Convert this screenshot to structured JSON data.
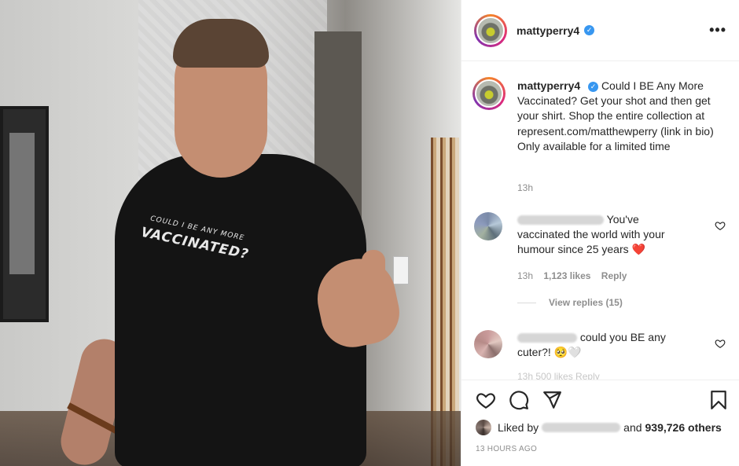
{
  "post": {
    "username": "mattyperry4",
    "verified_badge": "✓",
    "more_icon": "•••"
  },
  "photo": {
    "shirt_line1": "COULD I BE ANY MORE",
    "shirt_line2": "VACCINATED?"
  },
  "caption": {
    "username": "mattyperry4",
    "text": "Could I BE Any More Vaccinated? Get your shot and then get your shirt. Shop the entire collection at represent.com/matthewperry (link in bio) Only available for a limited time",
    "time": "13h"
  },
  "comments": [
    {
      "text": "You've vaccinated the world with your humour since 25 years",
      "emoji": "❤️",
      "time": "13h",
      "likes": "1,123 likes",
      "reply_label": "Reply",
      "view_replies": "View replies (15)"
    },
    {
      "text": "could you BE any cuter?!",
      "emoji": "🥺🤍",
      "partial_meta": "13h  500 likes  Reply"
    }
  ],
  "actions": {
    "liked_by_prefix": "Liked by",
    "liked_by_suffix_and": "and",
    "likes_count": "939,726 others",
    "time_ago": "13 HOURS AGO"
  },
  "colors": {
    "verified": "#3897f0",
    "text": "#262626",
    "muted": "#8e8e8e",
    "heart_red": "#ed1c24"
  }
}
